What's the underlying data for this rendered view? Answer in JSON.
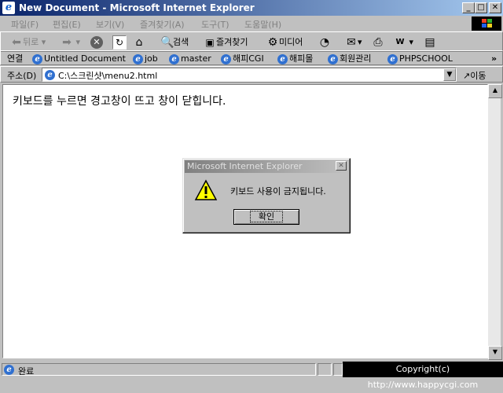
{
  "window": {
    "title": "New Document - Microsoft Internet Explorer",
    "min": "_",
    "max": "□",
    "close": "✕"
  },
  "menu": [
    "파일(F)",
    "편집(E)",
    "보기(V)",
    "즐겨찾기(A)",
    "도구(T)",
    "도움말(H)"
  ],
  "toolbar": {
    "back": "뒤로",
    "search": "검색",
    "favorites": "즐겨찾기",
    "media": "미디어"
  },
  "links": {
    "label": "연결",
    "items": [
      "Untitled Document",
      "job",
      "master",
      "해피CGI",
      "해피몰",
      "회원관리",
      "PHPSCHOOL"
    ],
    "more": "»"
  },
  "address": {
    "label": "주소(D)",
    "value": "C:\\스크린샷\\menu2.html",
    "go": "이동"
  },
  "content": {
    "text": "키보드를 누르면 경고창이 뜨고 창이 닫힙니다."
  },
  "dialog": {
    "title": "Microsoft Internet Explorer",
    "message": "키보드 사용이 금지됩니다.",
    "ok": "확인",
    "close": "✕"
  },
  "status": {
    "text": "완료",
    "copyright": "Copyright(c) http://www.happycgi.com"
  },
  "colors": {
    "titlebar_start": "#0a246a",
    "titlebar_end": "#a6caf0",
    "chrome": "#c0c0c0"
  }
}
